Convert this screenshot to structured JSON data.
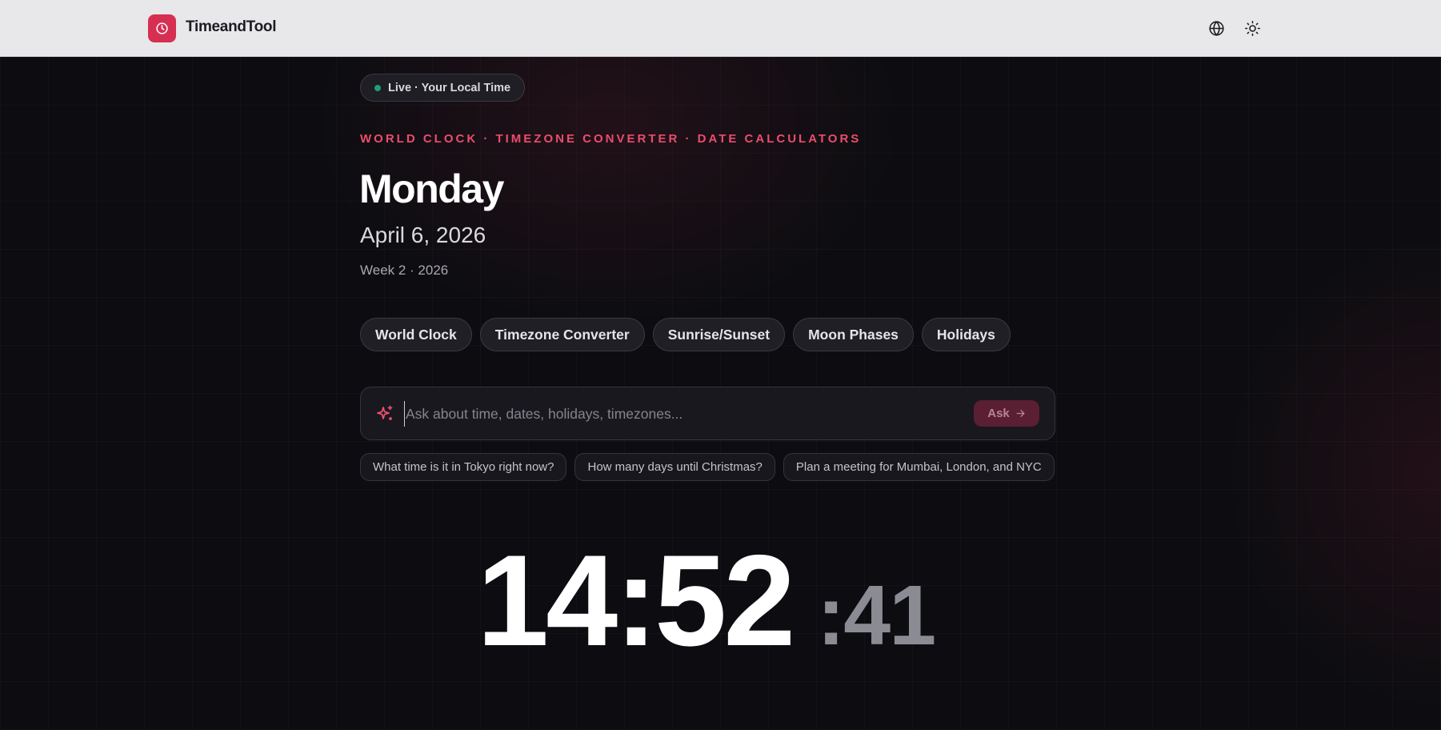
{
  "header": {
    "brand": "TimeandTool",
    "icons": [
      "clock-icon",
      "globe-icon",
      "sun-icon"
    ]
  },
  "hero": {
    "live_label": "Live · Your Local Time",
    "eyebrow": "WORLD CLOCK · TIMEZONE CONVERTER · DATE CALCULATORS",
    "day": "Monday",
    "date": "April 6, 2026",
    "week": "Week 2 · 2026"
  },
  "nav": {
    "items": [
      "World Clock",
      "Timezone Converter",
      "Sunrise/Sunset",
      "Moon Phases",
      "Holidays"
    ]
  },
  "ask": {
    "placeholder": "Ask about time, dates, holidays, timezones...",
    "value": "",
    "button_label": "Ask",
    "suggestions": [
      "What time is it in Tokyo right now?",
      "How many days until Christmas?",
      "Plan a meeting for Mumbai, London, and NYC"
    ]
  },
  "clock": {
    "hours_minutes": "14:52",
    "seconds": ":41"
  },
  "colors": {
    "accent": "#d62f52",
    "eyebrow": "#ea4d6c",
    "live_dot": "#1f9f72",
    "background": "#0d0d11",
    "header_bg": "#e8e7ea"
  }
}
